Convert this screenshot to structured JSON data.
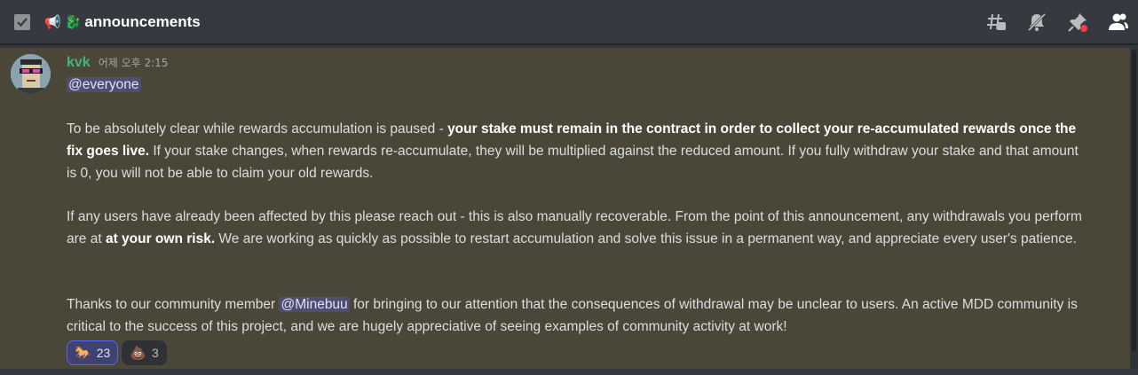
{
  "header": {
    "channel_name": "announcements",
    "megaphone_emoji": "📢",
    "dragon_emoji": "🐉"
  },
  "message": {
    "author": "kvk",
    "timestamp": "어제 오후 2:15",
    "everyone_mention": "@everyone",
    "p1": {
      "t1": "To be absolutely clear while rewards accumulation is paused - ",
      "b1": "your stake must remain in the contract in order to collect your re-accumulated rewards once the fix goes live.",
      "t2": " If your stake changes, when rewards re-accumulate, they will be multiplied against the reduced amount. If you fully withdraw your stake and that amount is 0, you will not be able to claim your old rewards."
    },
    "p2": {
      "t1": "If any users have already been affected by this please reach out - this is also manually recoverable. From the point of this announcement, any withdrawals you perform are at ",
      "b1": "at your own risk.",
      "t2": " We are working as quickly as possible to restart accumulation and solve this issue in a permanent way, and appreciate every user's patience."
    },
    "p3": {
      "t1": "Thanks to our community member ",
      "mention": "@Minebuu",
      "t2": " for bringing to our attention that the consequences of withdrawal may be unclear to users. An active MDD community is critical to the success of this project, and we are hugely appreciative of seeing examples of community activity at work!"
    }
  },
  "reactions": [
    {
      "emoji": "🐎",
      "count": "23",
      "active": true
    },
    {
      "emoji": "💩",
      "count": "3",
      "active": false
    }
  ],
  "colors": {
    "username": "#43b581",
    "highlight_bg": "#4a4739",
    "mention_bg": "#5865f2"
  }
}
